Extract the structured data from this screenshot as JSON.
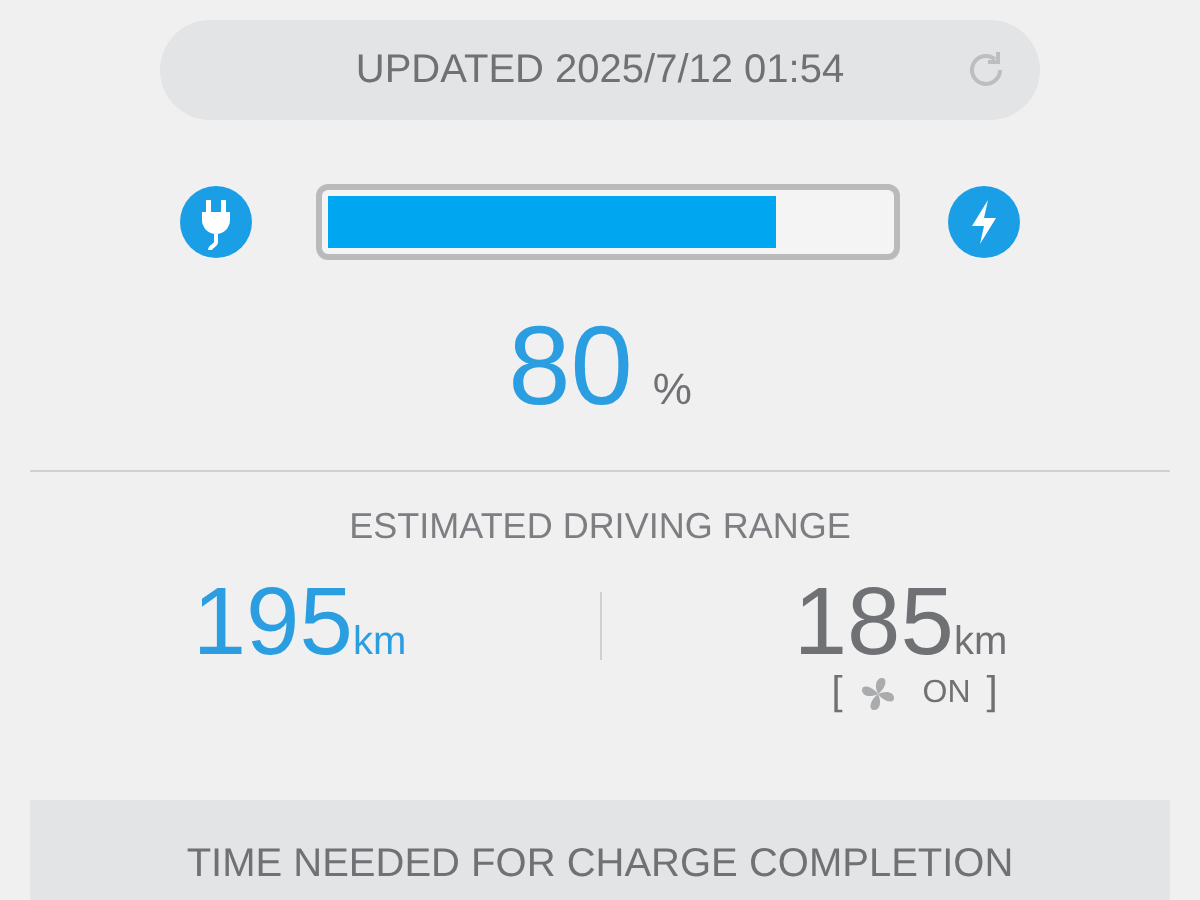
{
  "update_bar": {
    "label": "UPDATED 2025/7/12 01:54"
  },
  "battery": {
    "level": 0.8,
    "percent": "80",
    "unit": "%",
    "plugged": true,
    "charging": true
  },
  "range": {
    "title": "ESTIMATED DRIVING RANGE",
    "items": [
      {
        "kind": "standard",
        "value": "195",
        "unit": "km"
      },
      {
        "kind": "climate",
        "value": "185",
        "unit": "km",
        "bracket_open": "[",
        "state": "ON",
        "bracket_close": "]"
      }
    ]
  },
  "charge_time": {
    "title": "TIME NEEDED FOR CHARGE COMPLETION"
  }
}
